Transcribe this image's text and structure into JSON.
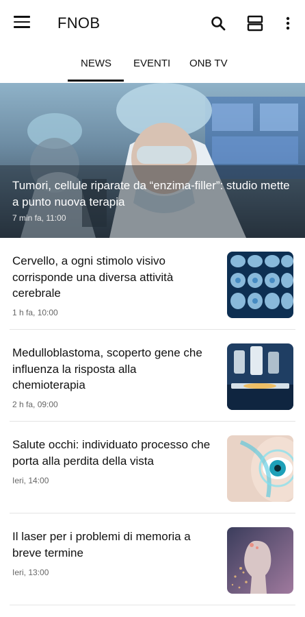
{
  "app": {
    "title": "FNOB"
  },
  "tabs": [
    {
      "label": "NEWS",
      "active": true
    },
    {
      "label": "EVENTI",
      "active": false
    },
    {
      "label": "ONB TV",
      "active": false
    }
  ],
  "hero": {
    "title": "Tumori, cellule riparate da “enzima-filler”: studio mette a punto nuova terapia",
    "time": "7 min fa, 11:00"
  },
  "articles": [
    {
      "title": "Cervello, a ogni stimolo visivo corrisponde una diversa attività cerebrale",
      "time": "1 h fa, 10:00"
    },
    {
      "title": "Medulloblastoma, scoperto gene che influenza la risposta alla chemioterapia",
      "time": "2 h fa, 09:00"
    },
    {
      "title": "Salute occhi: individuato processo che porta alla perdita della vista",
      "time": "Ieri, 14:00"
    },
    {
      "title": "Il laser per i problemi di memoria a breve termine",
      "time": "Ieri, 13:00"
    }
  ],
  "icons": [
    "menu-icon",
    "search-icon",
    "view-toggle-icon",
    "more-vert-icon"
  ],
  "colors": {
    "accent": "#111111",
    "divider": "#e4e4e4"
  }
}
